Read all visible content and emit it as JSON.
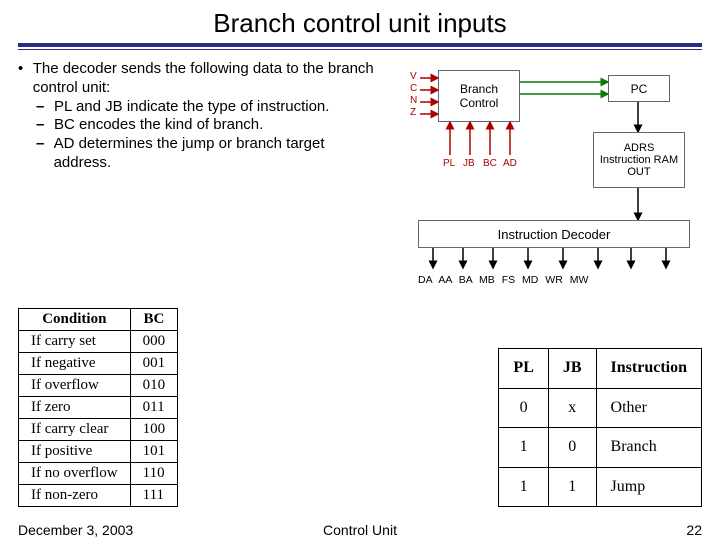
{
  "title": "Branch control unit inputs",
  "bullets": {
    "main": "The decoder sends the following data to the branch control unit:",
    "sub1": "PL and JB indicate the type of instruction.",
    "sub2": "BC encodes the kind of branch.",
    "sub3": "AD determines the jump or branch target address."
  },
  "diagram": {
    "bc": "Branch\nControl",
    "pc": "PC",
    "ram_top": "ADRS",
    "ram_mid": "Instruction RAM",
    "ram_bot": "OUT",
    "decoder": "Instruction Decoder",
    "flags": {
      "v": "V",
      "c": "C",
      "n": "N",
      "z": "Z"
    },
    "decoder_ins": {
      "pl": "PL",
      "jb": "JB",
      "bc": "BC",
      "ad": "AD"
    },
    "dec_out": "DA  AA  BA  MB  FS  MD WR MW"
  },
  "cond_table": {
    "h1": "Condition",
    "h2": "BC",
    "rows": [
      [
        "If carry set",
        "000"
      ],
      [
        "If negative",
        "001"
      ],
      [
        "If overflow",
        "010"
      ],
      [
        "If zero",
        "011"
      ],
      [
        "If carry clear",
        "100"
      ],
      [
        "If positive",
        "101"
      ],
      [
        "If no overflow",
        "110"
      ],
      [
        "If non-zero",
        "111"
      ]
    ]
  },
  "pljb_table": {
    "h1": "PL",
    "h2": "JB",
    "h3": "Instruction",
    "rows": [
      [
        "0",
        "x",
        "Other"
      ],
      [
        "1",
        "0",
        "Branch"
      ],
      [
        "1",
        "1",
        "Jump"
      ]
    ]
  },
  "footer": {
    "date": "December 3, 2003",
    "center": "Control Unit",
    "page": "22"
  }
}
